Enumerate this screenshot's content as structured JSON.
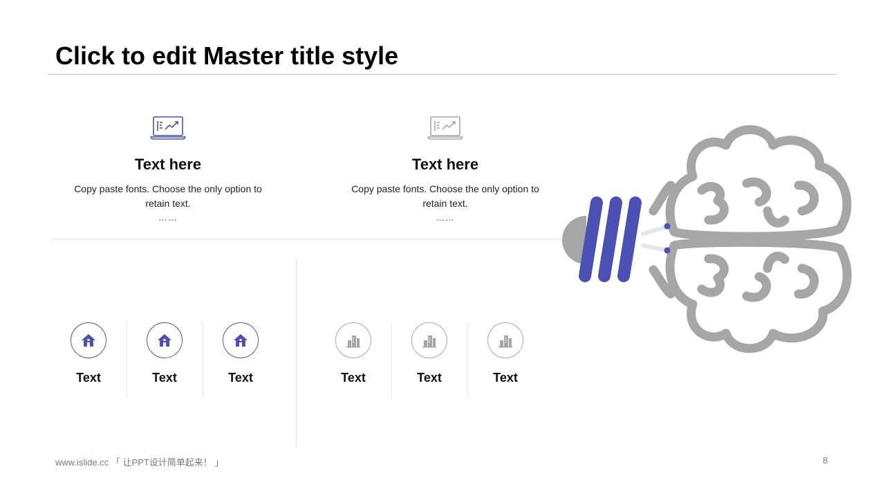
{
  "slide": {
    "title": "Click to edit Master title style",
    "page_number": "8"
  },
  "features": [
    {
      "icon": "laptop-chart-icon",
      "color": "#4a50b4",
      "heading": "Text here",
      "body": "Copy paste fonts. Choose the only option to retain text.",
      "ellipsis": "……"
    },
    {
      "icon": "laptop-chart-icon",
      "color": "#a6a6a6",
      "heading": "Text here",
      "body": "Copy paste fonts. Choose the only option to retain text.",
      "ellipsis": "……"
    }
  ],
  "items_left": [
    {
      "icon": "house-icon",
      "label": "Text"
    },
    {
      "icon": "house-icon",
      "label": "Text"
    },
    {
      "icon": "house-icon",
      "label": "Text"
    }
  ],
  "items_right": [
    {
      "icon": "city-buildings-icon",
      "label": "Text"
    },
    {
      "icon": "city-buildings-icon",
      "label": "Text"
    },
    {
      "icon": "city-buildings-icon",
      "label": "Text"
    }
  ],
  "illustration": {
    "icon": "brain-icon",
    "accent": "#4a50b4",
    "gray": "#a6a6a6"
  },
  "footer": {
    "text": "www.islide.cc 「 让PPT设计简单起来！ 」"
  },
  "colors": {
    "accent": "#4a50b4",
    "muted": "#a6a6a6"
  }
}
